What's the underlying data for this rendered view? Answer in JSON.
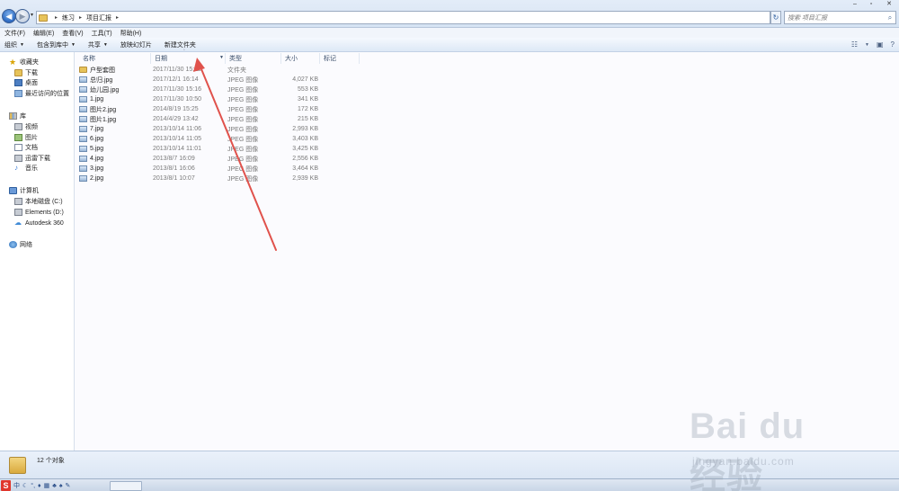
{
  "address": {
    "crumbs": [
      "练习",
      "项目汇报"
    ],
    "search_placeholder": "搜索 项目汇报"
  },
  "menu": [
    "文件(F)",
    "编辑(E)",
    "查看(V)",
    "工具(T)",
    "帮助(H)"
  ],
  "toolbar": {
    "organize": "组织",
    "include_library": "包含到库中",
    "share": "共享",
    "slideshow": "放映幻灯片",
    "new_folder": "新建文件夹"
  },
  "sidebar": {
    "favorites": {
      "label": "收藏夹",
      "items": [
        "下载",
        "桌面",
        "最近访问的位置"
      ]
    },
    "libraries": {
      "label": "库",
      "items": [
        "视频",
        "图片",
        "文档",
        "迅雷下载",
        "音乐"
      ]
    },
    "computer": {
      "label": "计算机",
      "items": [
        "本地磁盘 (C:)",
        "Elements (D:)",
        "Autodesk 360"
      ]
    },
    "network": {
      "label": "网络"
    }
  },
  "columns": {
    "name": "名称",
    "date": "日期",
    "type": "类型",
    "size": "大小",
    "tags": "标记"
  },
  "files": [
    {
      "name": "户型套图",
      "date": "2017/11/30 15:12",
      "type": "文件夹",
      "size": "",
      "icon": "folder"
    },
    {
      "name": "总归.jpg",
      "date": "2017/12/1 16:14",
      "type": "JPEG 图像",
      "size": "4,027 KB",
      "icon": "jpg"
    },
    {
      "name": "幼儿园.jpg",
      "date": "2017/11/30 15:16",
      "type": "JPEG 图像",
      "size": "553 KB",
      "icon": "jpg"
    },
    {
      "name": "1.jpg",
      "date": "2017/11/30 10:50",
      "type": "JPEG 图像",
      "size": "341 KB",
      "icon": "jpg"
    },
    {
      "name": "图片2.jpg",
      "date": "2014/8/19 15:25",
      "type": "JPEG 图像",
      "size": "172 KB",
      "icon": "jpg"
    },
    {
      "name": "图片1.jpg",
      "date": "2014/4/29 13:42",
      "type": "JPEG 图像",
      "size": "215 KB",
      "icon": "jpg"
    },
    {
      "name": "7.jpg",
      "date": "2013/10/14 11:06",
      "type": "JPEG 图像",
      "size": "2,993 KB",
      "icon": "jpg"
    },
    {
      "name": "6.jpg",
      "date": "2013/10/14 11:05",
      "type": "JPEG 图像",
      "size": "3,403 KB",
      "icon": "jpg"
    },
    {
      "name": "5.jpg",
      "date": "2013/10/14 11:01",
      "type": "JPEG 图像",
      "size": "3,425 KB",
      "icon": "jpg"
    },
    {
      "name": "4.jpg",
      "date": "2013/8/7 16:09",
      "type": "JPEG 图像",
      "size": "2,556 KB",
      "icon": "jpg"
    },
    {
      "name": "3.jpg",
      "date": "2013/8/1 16:06",
      "type": "JPEG 图像",
      "size": "3,464 KB",
      "icon": "jpg"
    },
    {
      "name": "2.jpg",
      "date": "2013/8/1 10:07",
      "type": "JPEG 图像",
      "size": "2,939 KB",
      "icon": "jpg"
    }
  ],
  "status": {
    "count": "12 个对象"
  },
  "taskbar": {
    "ime_items": [
      "S",
      "中"
    ]
  },
  "watermark": {
    "brand": "Bai du 经验",
    "url": "jingyan.baidu.com"
  },
  "colors": {
    "annotation_arrow": "#e0524c",
    "accent": "#2e6cc4"
  }
}
